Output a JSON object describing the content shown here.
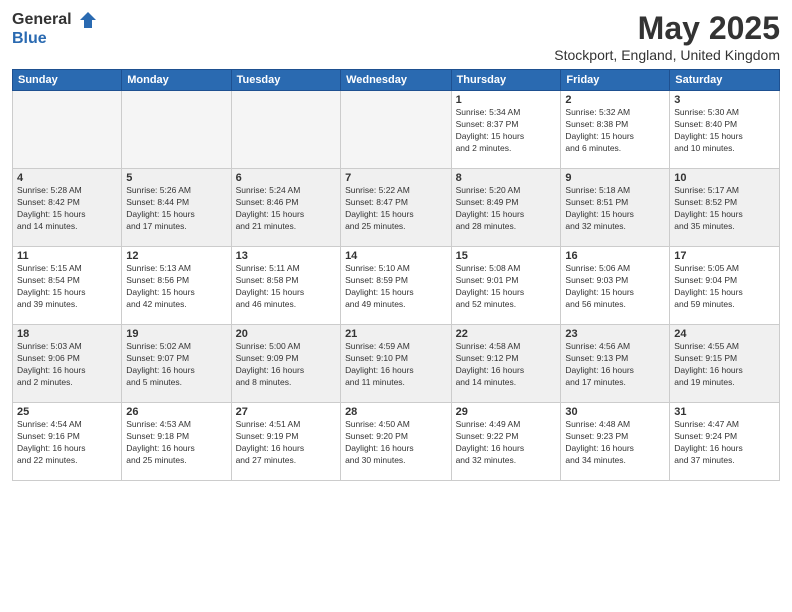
{
  "logo": {
    "general": "General",
    "blue": "Blue"
  },
  "header": {
    "title": "May 2025",
    "location": "Stockport, England, United Kingdom"
  },
  "weekdays": [
    "Sunday",
    "Monday",
    "Tuesday",
    "Wednesday",
    "Thursday",
    "Friday",
    "Saturday"
  ],
  "weeks": [
    [
      {
        "day": "",
        "info": ""
      },
      {
        "day": "",
        "info": ""
      },
      {
        "day": "",
        "info": ""
      },
      {
        "day": "",
        "info": ""
      },
      {
        "day": "1",
        "info": "Sunrise: 5:34 AM\nSunset: 8:37 PM\nDaylight: 15 hours\nand 2 minutes."
      },
      {
        "day": "2",
        "info": "Sunrise: 5:32 AM\nSunset: 8:38 PM\nDaylight: 15 hours\nand 6 minutes."
      },
      {
        "day": "3",
        "info": "Sunrise: 5:30 AM\nSunset: 8:40 PM\nDaylight: 15 hours\nand 10 minutes."
      }
    ],
    [
      {
        "day": "4",
        "info": "Sunrise: 5:28 AM\nSunset: 8:42 PM\nDaylight: 15 hours\nand 14 minutes."
      },
      {
        "day": "5",
        "info": "Sunrise: 5:26 AM\nSunset: 8:44 PM\nDaylight: 15 hours\nand 17 minutes."
      },
      {
        "day": "6",
        "info": "Sunrise: 5:24 AM\nSunset: 8:46 PM\nDaylight: 15 hours\nand 21 minutes."
      },
      {
        "day": "7",
        "info": "Sunrise: 5:22 AM\nSunset: 8:47 PM\nDaylight: 15 hours\nand 25 minutes."
      },
      {
        "day": "8",
        "info": "Sunrise: 5:20 AM\nSunset: 8:49 PM\nDaylight: 15 hours\nand 28 minutes."
      },
      {
        "day": "9",
        "info": "Sunrise: 5:18 AM\nSunset: 8:51 PM\nDaylight: 15 hours\nand 32 minutes."
      },
      {
        "day": "10",
        "info": "Sunrise: 5:17 AM\nSunset: 8:52 PM\nDaylight: 15 hours\nand 35 minutes."
      }
    ],
    [
      {
        "day": "11",
        "info": "Sunrise: 5:15 AM\nSunset: 8:54 PM\nDaylight: 15 hours\nand 39 minutes."
      },
      {
        "day": "12",
        "info": "Sunrise: 5:13 AM\nSunset: 8:56 PM\nDaylight: 15 hours\nand 42 minutes."
      },
      {
        "day": "13",
        "info": "Sunrise: 5:11 AM\nSunset: 8:58 PM\nDaylight: 15 hours\nand 46 minutes."
      },
      {
        "day": "14",
        "info": "Sunrise: 5:10 AM\nSunset: 8:59 PM\nDaylight: 15 hours\nand 49 minutes."
      },
      {
        "day": "15",
        "info": "Sunrise: 5:08 AM\nSunset: 9:01 PM\nDaylight: 15 hours\nand 52 minutes."
      },
      {
        "day": "16",
        "info": "Sunrise: 5:06 AM\nSunset: 9:03 PM\nDaylight: 15 hours\nand 56 minutes."
      },
      {
        "day": "17",
        "info": "Sunrise: 5:05 AM\nSunset: 9:04 PM\nDaylight: 15 hours\nand 59 minutes."
      }
    ],
    [
      {
        "day": "18",
        "info": "Sunrise: 5:03 AM\nSunset: 9:06 PM\nDaylight: 16 hours\nand 2 minutes."
      },
      {
        "day": "19",
        "info": "Sunrise: 5:02 AM\nSunset: 9:07 PM\nDaylight: 16 hours\nand 5 minutes."
      },
      {
        "day": "20",
        "info": "Sunrise: 5:00 AM\nSunset: 9:09 PM\nDaylight: 16 hours\nand 8 minutes."
      },
      {
        "day": "21",
        "info": "Sunrise: 4:59 AM\nSunset: 9:10 PM\nDaylight: 16 hours\nand 11 minutes."
      },
      {
        "day": "22",
        "info": "Sunrise: 4:58 AM\nSunset: 9:12 PM\nDaylight: 16 hours\nand 14 minutes."
      },
      {
        "day": "23",
        "info": "Sunrise: 4:56 AM\nSunset: 9:13 PM\nDaylight: 16 hours\nand 17 minutes."
      },
      {
        "day": "24",
        "info": "Sunrise: 4:55 AM\nSunset: 9:15 PM\nDaylight: 16 hours\nand 19 minutes."
      }
    ],
    [
      {
        "day": "25",
        "info": "Sunrise: 4:54 AM\nSunset: 9:16 PM\nDaylight: 16 hours\nand 22 minutes."
      },
      {
        "day": "26",
        "info": "Sunrise: 4:53 AM\nSunset: 9:18 PM\nDaylight: 16 hours\nand 25 minutes."
      },
      {
        "day": "27",
        "info": "Sunrise: 4:51 AM\nSunset: 9:19 PM\nDaylight: 16 hours\nand 27 minutes."
      },
      {
        "day": "28",
        "info": "Sunrise: 4:50 AM\nSunset: 9:20 PM\nDaylight: 16 hours\nand 30 minutes."
      },
      {
        "day": "29",
        "info": "Sunrise: 4:49 AM\nSunset: 9:22 PM\nDaylight: 16 hours\nand 32 minutes."
      },
      {
        "day": "30",
        "info": "Sunrise: 4:48 AM\nSunset: 9:23 PM\nDaylight: 16 hours\nand 34 minutes."
      },
      {
        "day": "31",
        "info": "Sunrise: 4:47 AM\nSunset: 9:24 PM\nDaylight: 16 hours\nand 37 minutes."
      }
    ]
  ]
}
